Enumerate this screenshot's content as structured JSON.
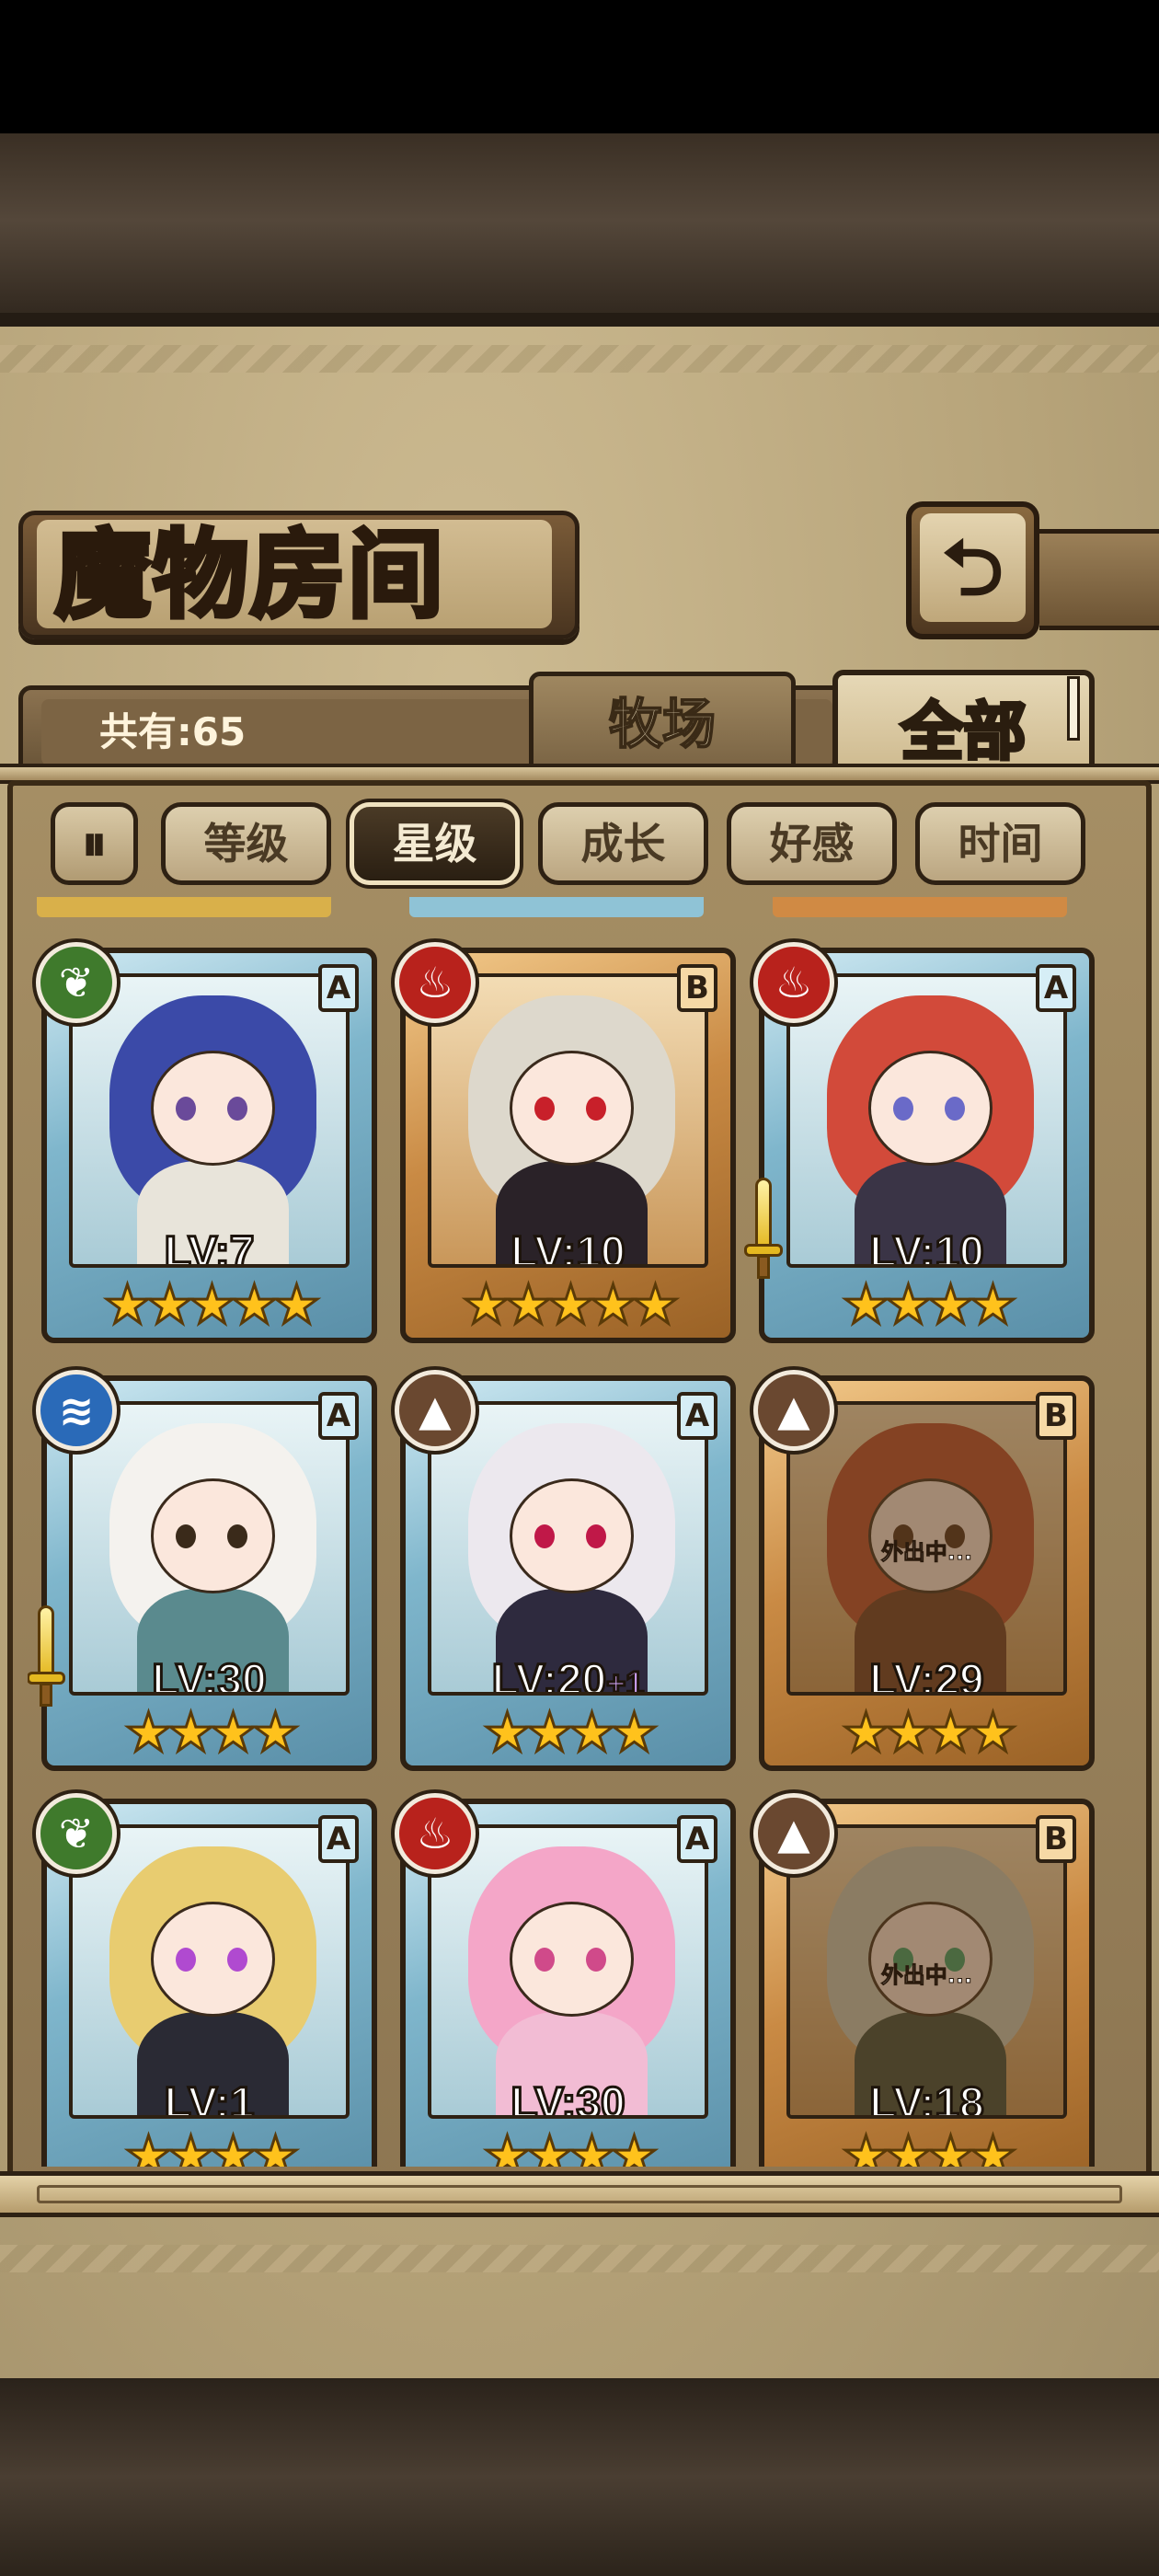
{
  "header": {
    "title": "魔物房间",
    "back_icon": "return-arrow-icon"
  },
  "tabs": {
    "count_label": "共有:65",
    "ranch": "牧场",
    "all": "全部",
    "active": "全部"
  },
  "sort": {
    "toggle_icon": "sort-order-toggle-icon",
    "buttons": [
      "等级",
      "星级",
      "成长",
      "好感",
      "时间"
    ],
    "active": "星级"
  },
  "monsters": [
    {
      "element": "leaf",
      "grade": "A",
      "level": "LV:7",
      "stars": 5,
      "weapon": false,
      "away": "",
      "bonus": "",
      "hair": "#3b4aa8",
      "body": "#e8e4da",
      "eye": "#6a4a9a"
    },
    {
      "element": "fire",
      "grade": "B",
      "level": "LV:10",
      "stars": 5,
      "weapon": false,
      "away": "",
      "bonus": "",
      "hair": "#ddd8cc",
      "body": "#2a2228",
      "eye": "#c8202a"
    },
    {
      "element": "fire",
      "grade": "A",
      "level": "LV:10",
      "stars": 4,
      "weapon": true,
      "away": "",
      "bonus": "",
      "hair": "#d24a3a",
      "body": "#3a3446",
      "eye": "#6a6ac8"
    },
    {
      "element": "water",
      "grade": "A",
      "level": "LV:30",
      "stars": 4,
      "weapon": true,
      "away": "",
      "bonus": "",
      "hair": "#f4f2ee",
      "body": "#5a8a8e",
      "eye": "#3a2a1a"
    },
    {
      "element": "earth",
      "grade": "A",
      "level": "LV:20",
      "stars": 4,
      "weapon": false,
      "away": "",
      "bonus": "+1",
      "hair": "#ece8ee",
      "body": "#2e2a3e",
      "eye": "#c01848"
    },
    {
      "element": "earth",
      "grade": "B",
      "level": "LV:29",
      "stars": 4,
      "weapon": false,
      "away": "外出中...",
      "bonus": "",
      "hair": "#b84a2a",
      "body": "#6a3a22",
      "eye": "#4a2a18"
    },
    {
      "element": "leaf",
      "grade": "A",
      "level": "LV:1",
      "stars": 4,
      "weapon": false,
      "away": "",
      "bonus": "",
      "hair": "#e8cc70",
      "body": "#2a2a34",
      "eye": "#b04ad0"
    },
    {
      "element": "fire",
      "grade": "A",
      "level": "LV:30",
      "stars": 4,
      "weapon": false,
      "away": "",
      "bonus": "",
      "hair": "#f4a6c8",
      "body": "#f2bcd4",
      "eye": "#d04a8a"
    },
    {
      "element": "earth",
      "grade": "B",
      "level": "LV:18",
      "stars": 4,
      "weapon": false,
      "away": "外出中...",
      "bonus": "",
      "hair": "#c8cbb8",
      "body": "#3a4a3a",
      "eye": "#3aa06a"
    }
  ],
  "element_icons": {
    "leaf": {
      "color": "#3f7a2c",
      "glyph": "❦"
    },
    "fire": {
      "color": "#b8221c",
      "glyph": "♨"
    },
    "water": {
      "color": "#2a6ab8",
      "glyph": "≋"
    },
    "earth": {
      "color": "#6a4830",
      "glyph": "▲"
    }
  },
  "colors": {
    "frame_A": "#7fb6cc",
    "frame_B": "#c98a44",
    "star": "#ffc21c"
  }
}
